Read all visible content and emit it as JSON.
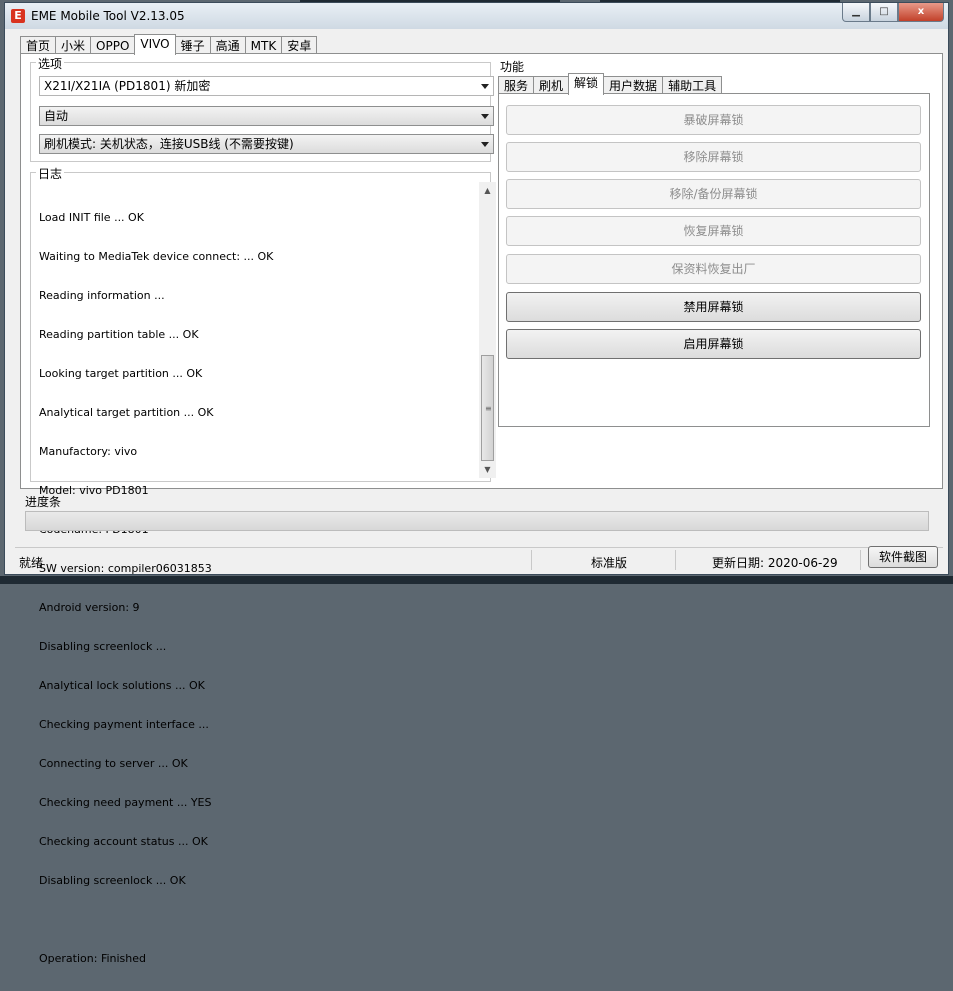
{
  "window": {
    "title": "EME Mobile Tool V2.13.05",
    "icon_letter": "E",
    "controls": {
      "minimize": "▁",
      "maximize": "□",
      "close": "x"
    }
  },
  "main_tabs": [
    "首页",
    "小米",
    "OPPO",
    "VIVO",
    "锤子",
    "高通",
    "MTK",
    "安卓"
  ],
  "active_main_tab": "VIVO",
  "options": {
    "label": "选项",
    "model_select": "X21I/X21IA (PD1801) 新加密",
    "mode_select": "自动",
    "flash_mode_select": "刷机模式: 关机状态，连接USB线 (不需要按键)"
  },
  "log": {
    "label": "日志",
    "lines": [
      "Load INIT file ... OK",
      "Waiting to MediaTek device connect: ... OK",
      "Reading information ...",
      "Reading partition table ... OK",
      "Looking target partition ... OK",
      "Analytical target partition ... OK",
      "Manufactory: vivo",
      "Model: vivo PD1801",
      "Codename: PD1801",
      "SW version: compiler06031853",
      "Android version: 9",
      "Disabling screenlock ...",
      "Analytical lock solutions ... OK",
      "Checking payment interface ...",
      "Connecting to server ... OK",
      "Checking need payment ... YES",
      "Checking account status ... OK",
      "Disabling screenlock ... OK",
      "",
      "Operation: Finished"
    ]
  },
  "functions": {
    "label": "功能",
    "tabs": [
      "服务",
      "刷机",
      "解锁",
      "用户数据",
      "辅助工具"
    ],
    "active_tab": "解锁",
    "buttons": [
      {
        "label": "暴破屏幕锁",
        "enabled": false
      },
      {
        "label": "移除屏幕锁",
        "enabled": false
      },
      {
        "label": "移除/备份屏幕锁",
        "enabled": false
      },
      {
        "label": "恢复屏幕锁",
        "enabled": false
      },
      {
        "label": "保资料恢复出厂",
        "enabled": false
      },
      {
        "label": "禁用屏幕锁",
        "enabled": true
      },
      {
        "label": "启用屏幕锁",
        "enabled": true
      }
    ]
  },
  "progress": {
    "label": "进度条",
    "value": 0
  },
  "status": {
    "state": "就绪",
    "edition": "标准版",
    "update_date": "更新日期: 2020-06-29",
    "screenshot_button": "软件截图"
  },
  "colors": {
    "accent": "#d9331f",
    "progress": "#06b025"
  }
}
